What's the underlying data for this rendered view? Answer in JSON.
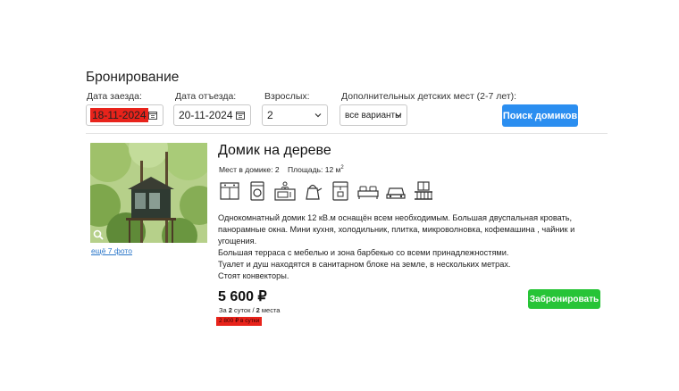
{
  "booking": {
    "title": "Бронирование",
    "checkin": {
      "label": "Дата заезда:",
      "value": "18-11-2024"
    },
    "checkout": {
      "label": "Дата отъезда:",
      "value": "20-11-2024"
    },
    "adults": {
      "label": "Взрослых:",
      "value": "2"
    },
    "kids": {
      "label": "Дополнительных детских мест (2-7 лет):",
      "value": "все варианты"
    },
    "search_label": "Поиск домиков",
    "highlight_color": "#e8231b",
    "accent_color": "#2b8ef0"
  },
  "listing": {
    "title": "Домик на дереве",
    "more_photos": "ещё 7 фото",
    "places": "Мест в домике: 2",
    "area": "Площадь: 12 м",
    "area_sup": "2",
    "amenities": [
      "kitchen-icon",
      "washing-machine-icon",
      "microwave-icon",
      "kettle-icon",
      "coffee-machine-icon",
      "bed-icon",
      "car-icon",
      "balcony-icon"
    ],
    "description": [
      "Однокомнатный домик 12 кВ.м оснащён всем необходимым. Большая двуспальная кровать,",
      "панорамные окна. Мини кухня, холодильник, плитка, микроволновка, кофемашина , чайник и",
      "угощения.",
      "Большая терраса с мебелью и зона барбекью со всеми принадлежностями.",
      "Туалет и душ находятся в санитарном блоке на земле, в нескольких метрах.",
      "Стоят конвекторы."
    ],
    "price": "5 600 ₽",
    "nights_prefix": "За ",
    "nights_count": "2",
    "nights_mid": " суток / ",
    "places_count": "2",
    "nights_suffix": " места",
    "per_day": "2 800 ₽ в сутки",
    "book_label": "Забронировать",
    "book_color": "#27c437"
  }
}
